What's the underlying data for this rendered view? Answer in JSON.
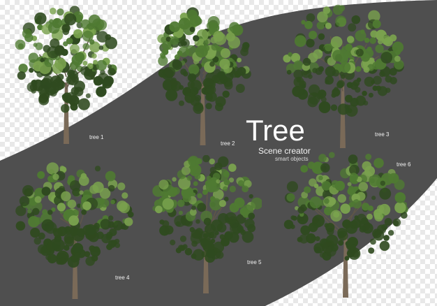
{
  "title": "Tree",
  "subtitle": "Scene creator",
  "tagline": "smart objects",
  "colors": {
    "band": "#4f4f4f",
    "leaf_dark": "#2f4a1f",
    "leaf_mid": "#4f7a32",
    "leaf_light": "#7aa24e",
    "trunk": "#7a6a58"
  },
  "trees": [
    {
      "id": "tree-1",
      "label": "tree 1"
    },
    {
      "id": "tree-2",
      "label": "tree 2"
    },
    {
      "id": "tree-3",
      "label": "tree 3"
    },
    {
      "id": "tree-4",
      "label": "tree 4"
    },
    {
      "id": "tree-5",
      "label": "tree 5"
    },
    {
      "id": "tree-6",
      "label": "tree 6"
    }
  ]
}
